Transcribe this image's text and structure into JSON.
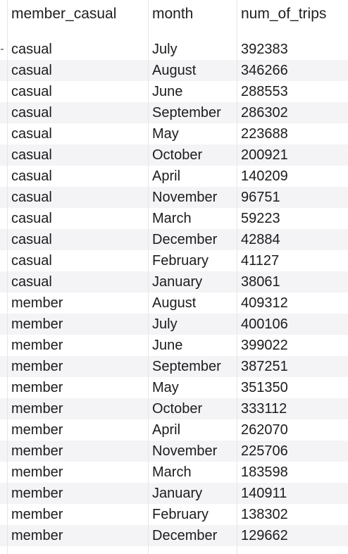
{
  "table": {
    "columns": [
      "member_casual",
      "month",
      "num_of_trips"
    ],
    "rows": [
      [
        "casual",
        "July",
        "392383"
      ],
      [
        "casual",
        "August",
        "346266"
      ],
      [
        "casual",
        "June",
        "288553"
      ],
      [
        "casual",
        "September",
        "286302"
      ],
      [
        "casual",
        "May",
        "223688"
      ],
      [
        "casual",
        "October",
        "200921"
      ],
      [
        "casual",
        "April",
        "140209"
      ],
      [
        "casual",
        "November",
        "96751"
      ],
      [
        "casual",
        "March",
        "59223"
      ],
      [
        "casual",
        "December",
        "42884"
      ],
      [
        "casual",
        "February",
        "41127"
      ],
      [
        "casual",
        "January",
        "38061"
      ],
      [
        "member",
        "August",
        "409312"
      ],
      [
        "member",
        "July",
        "400106"
      ],
      [
        "member",
        "June",
        "399022"
      ],
      [
        "member",
        "September",
        "387251"
      ],
      [
        "member",
        "May",
        "351350"
      ],
      [
        "member",
        "October",
        "333112"
      ],
      [
        "member",
        "April",
        "262070"
      ],
      [
        "member",
        "November",
        "225706"
      ],
      [
        "member",
        "March",
        "183598"
      ],
      [
        "member",
        "January",
        "140911"
      ],
      [
        "member",
        "February",
        "138302"
      ],
      [
        "member",
        "December",
        "129662"
      ]
    ]
  }
}
